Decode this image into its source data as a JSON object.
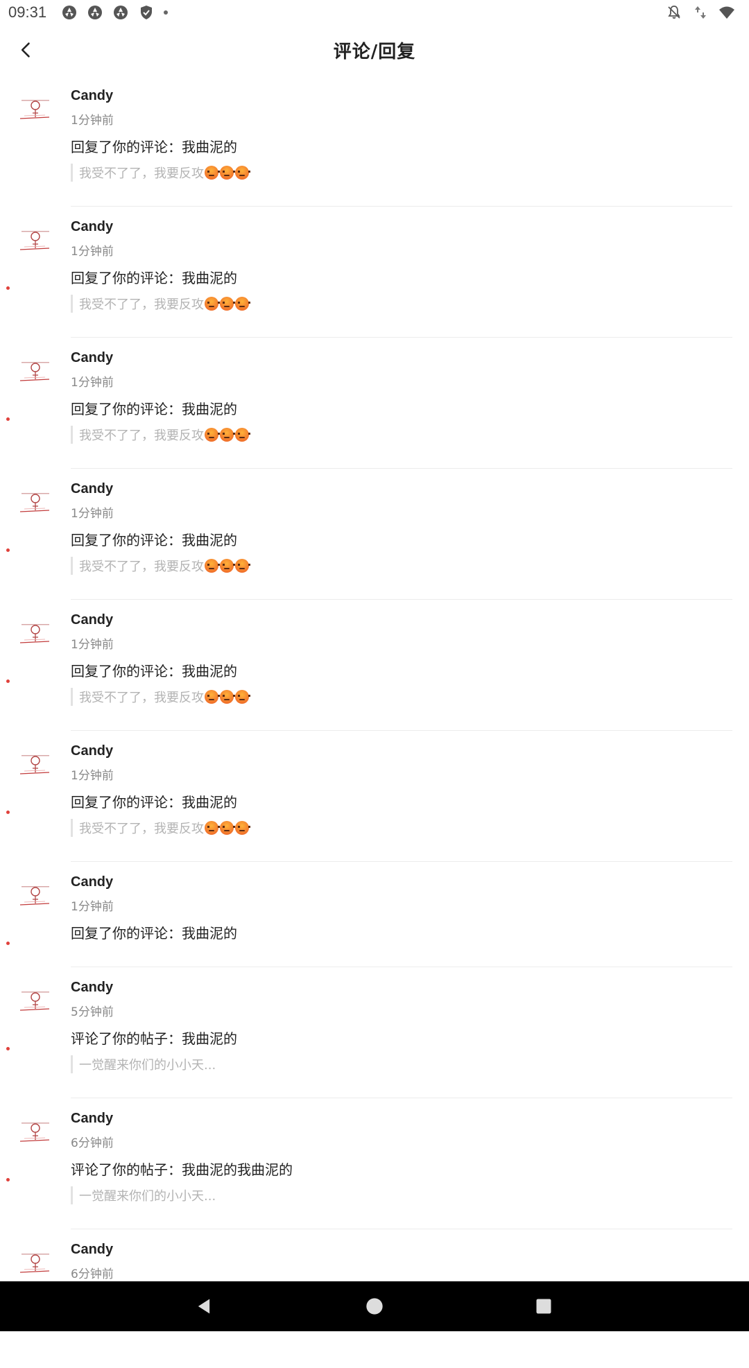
{
  "status_bar": {
    "time": "09:31",
    "notification_icons": [
      "aperture-icon",
      "aperture-icon",
      "aperture-icon",
      "shield-icon",
      "dot-icon"
    ],
    "right_icons": [
      "notifications-off-icon",
      "data-arrows-icon",
      "wifi-icon"
    ]
  },
  "header": {
    "title": "评论/回复",
    "back_icon": "chevron-left-icon"
  },
  "colors": {
    "unread_dot": "#e0413b",
    "divider": "#ececec",
    "quote_text": "#b3b3b3"
  },
  "items": [
    {
      "username": "Candy",
      "time": "1分钟前",
      "message": "回复了你的评论：我曲泥的",
      "quote": "我受不了了，我要反攻",
      "quote_emoji": [
        "angry-face",
        "angry-face",
        "angry-face"
      ],
      "unread": false
    },
    {
      "username": "Candy",
      "time": "1分钟前",
      "message": "回复了你的评论：我曲泥的",
      "quote": "我受不了了，我要反攻",
      "quote_emoji": [
        "angry-face",
        "angry-face",
        "angry-face"
      ],
      "unread": true
    },
    {
      "username": "Candy",
      "time": "1分钟前",
      "message": "回复了你的评论：我曲泥的",
      "quote": "我受不了了，我要反攻",
      "quote_emoji": [
        "angry-face",
        "angry-face",
        "angry-face"
      ],
      "unread": true
    },
    {
      "username": "Candy",
      "time": "1分钟前",
      "message": "回复了你的评论：我曲泥的",
      "quote": "我受不了了，我要反攻",
      "quote_emoji": [
        "angry-face",
        "angry-face",
        "angry-face"
      ],
      "unread": true
    },
    {
      "username": "Candy",
      "time": "1分钟前",
      "message": "回复了你的评论：我曲泥的",
      "quote": "我受不了了，我要反攻",
      "quote_emoji": [
        "angry-face",
        "angry-face",
        "angry-face"
      ],
      "unread": true
    },
    {
      "username": "Candy",
      "time": "1分钟前",
      "message": "回复了你的评论：我曲泥的",
      "quote": "我受不了了，我要反攻",
      "quote_emoji": [
        "angry-face",
        "angry-face",
        "angry-face"
      ],
      "unread": true
    },
    {
      "username": "Candy",
      "time": "1分钟前",
      "message": "回复了你的评论：我曲泥的",
      "quote": "",
      "quote_emoji": [],
      "unread": true
    },
    {
      "username": "Candy",
      "time": "5分钟前",
      "message": "评论了你的帖子：我曲泥的",
      "quote": "一觉醒来你们的小小天...",
      "quote_emoji": [],
      "unread": true
    },
    {
      "username": "Candy",
      "time": "6分钟前",
      "message": "评论了你的帖子：我曲泥的我曲泥的",
      "quote": "一觉醒来你们的小小天...",
      "quote_emoji": [],
      "unread": true
    },
    {
      "username": "Candy",
      "time": "6分钟前",
      "message": "",
      "quote": "",
      "quote_emoji": [],
      "unread": true
    }
  ],
  "nav_bar": {
    "buttons": [
      "back-triangle-icon",
      "home-circle-icon",
      "recents-square-icon"
    ]
  }
}
